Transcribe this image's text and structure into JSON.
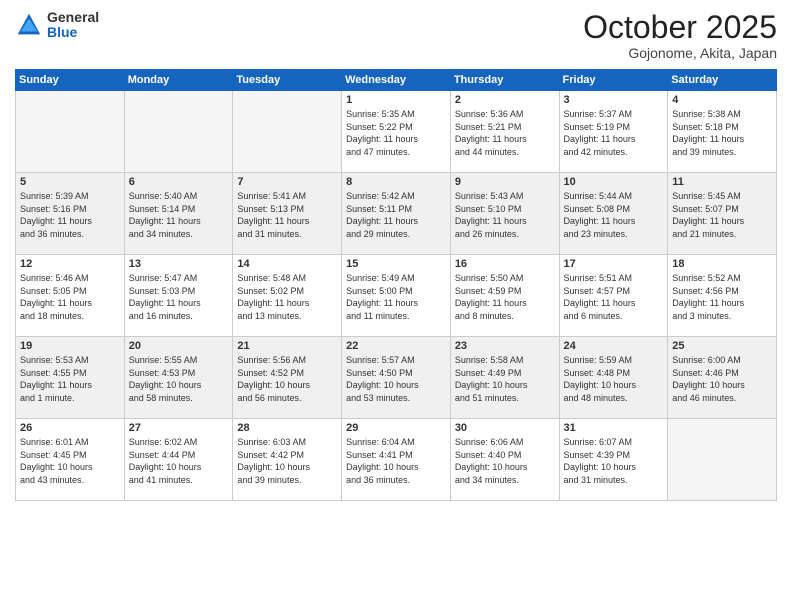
{
  "header": {
    "logo_general": "General",
    "logo_blue": "Blue",
    "title": "October 2025",
    "subtitle": "Gojonome, Akita, Japan"
  },
  "days_of_week": [
    "Sunday",
    "Monday",
    "Tuesday",
    "Wednesday",
    "Thursday",
    "Friday",
    "Saturday"
  ],
  "weeks": [
    [
      {
        "num": "",
        "info": ""
      },
      {
        "num": "",
        "info": ""
      },
      {
        "num": "",
        "info": ""
      },
      {
        "num": "1",
        "info": "Sunrise: 5:35 AM\nSunset: 5:22 PM\nDaylight: 11 hours\nand 47 minutes."
      },
      {
        "num": "2",
        "info": "Sunrise: 5:36 AM\nSunset: 5:21 PM\nDaylight: 11 hours\nand 44 minutes."
      },
      {
        "num": "3",
        "info": "Sunrise: 5:37 AM\nSunset: 5:19 PM\nDaylight: 11 hours\nand 42 minutes."
      },
      {
        "num": "4",
        "info": "Sunrise: 5:38 AM\nSunset: 5:18 PM\nDaylight: 11 hours\nand 39 minutes."
      }
    ],
    [
      {
        "num": "5",
        "info": "Sunrise: 5:39 AM\nSunset: 5:16 PM\nDaylight: 11 hours\nand 36 minutes."
      },
      {
        "num": "6",
        "info": "Sunrise: 5:40 AM\nSunset: 5:14 PM\nDaylight: 11 hours\nand 34 minutes."
      },
      {
        "num": "7",
        "info": "Sunrise: 5:41 AM\nSunset: 5:13 PM\nDaylight: 11 hours\nand 31 minutes."
      },
      {
        "num": "8",
        "info": "Sunrise: 5:42 AM\nSunset: 5:11 PM\nDaylight: 11 hours\nand 29 minutes."
      },
      {
        "num": "9",
        "info": "Sunrise: 5:43 AM\nSunset: 5:10 PM\nDaylight: 11 hours\nand 26 minutes."
      },
      {
        "num": "10",
        "info": "Sunrise: 5:44 AM\nSunset: 5:08 PM\nDaylight: 11 hours\nand 23 minutes."
      },
      {
        "num": "11",
        "info": "Sunrise: 5:45 AM\nSunset: 5:07 PM\nDaylight: 11 hours\nand 21 minutes."
      }
    ],
    [
      {
        "num": "12",
        "info": "Sunrise: 5:46 AM\nSunset: 5:05 PM\nDaylight: 11 hours\nand 18 minutes."
      },
      {
        "num": "13",
        "info": "Sunrise: 5:47 AM\nSunset: 5:03 PM\nDaylight: 11 hours\nand 16 minutes."
      },
      {
        "num": "14",
        "info": "Sunrise: 5:48 AM\nSunset: 5:02 PM\nDaylight: 11 hours\nand 13 minutes."
      },
      {
        "num": "15",
        "info": "Sunrise: 5:49 AM\nSunset: 5:00 PM\nDaylight: 11 hours\nand 11 minutes."
      },
      {
        "num": "16",
        "info": "Sunrise: 5:50 AM\nSunset: 4:59 PM\nDaylight: 11 hours\nand 8 minutes."
      },
      {
        "num": "17",
        "info": "Sunrise: 5:51 AM\nSunset: 4:57 PM\nDaylight: 11 hours\nand 6 minutes."
      },
      {
        "num": "18",
        "info": "Sunrise: 5:52 AM\nSunset: 4:56 PM\nDaylight: 11 hours\nand 3 minutes."
      }
    ],
    [
      {
        "num": "19",
        "info": "Sunrise: 5:53 AM\nSunset: 4:55 PM\nDaylight: 11 hours\nand 1 minute."
      },
      {
        "num": "20",
        "info": "Sunrise: 5:55 AM\nSunset: 4:53 PM\nDaylight: 10 hours\nand 58 minutes."
      },
      {
        "num": "21",
        "info": "Sunrise: 5:56 AM\nSunset: 4:52 PM\nDaylight: 10 hours\nand 56 minutes."
      },
      {
        "num": "22",
        "info": "Sunrise: 5:57 AM\nSunset: 4:50 PM\nDaylight: 10 hours\nand 53 minutes."
      },
      {
        "num": "23",
        "info": "Sunrise: 5:58 AM\nSunset: 4:49 PM\nDaylight: 10 hours\nand 51 minutes."
      },
      {
        "num": "24",
        "info": "Sunrise: 5:59 AM\nSunset: 4:48 PM\nDaylight: 10 hours\nand 48 minutes."
      },
      {
        "num": "25",
        "info": "Sunrise: 6:00 AM\nSunset: 4:46 PM\nDaylight: 10 hours\nand 46 minutes."
      }
    ],
    [
      {
        "num": "26",
        "info": "Sunrise: 6:01 AM\nSunset: 4:45 PM\nDaylight: 10 hours\nand 43 minutes."
      },
      {
        "num": "27",
        "info": "Sunrise: 6:02 AM\nSunset: 4:44 PM\nDaylight: 10 hours\nand 41 minutes."
      },
      {
        "num": "28",
        "info": "Sunrise: 6:03 AM\nSunset: 4:42 PM\nDaylight: 10 hours\nand 39 minutes."
      },
      {
        "num": "29",
        "info": "Sunrise: 6:04 AM\nSunset: 4:41 PM\nDaylight: 10 hours\nand 36 minutes."
      },
      {
        "num": "30",
        "info": "Sunrise: 6:06 AM\nSunset: 4:40 PM\nDaylight: 10 hours\nand 34 minutes."
      },
      {
        "num": "31",
        "info": "Sunrise: 6:07 AM\nSunset: 4:39 PM\nDaylight: 10 hours\nand 31 minutes."
      },
      {
        "num": "",
        "info": ""
      }
    ]
  ]
}
